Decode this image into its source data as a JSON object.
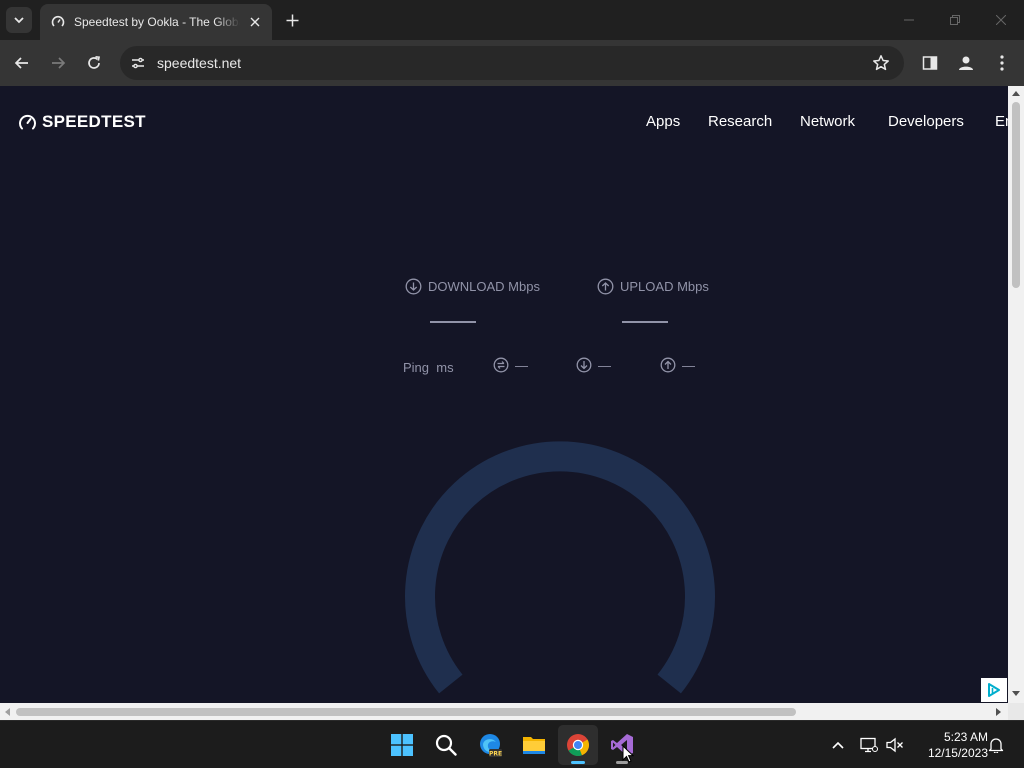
{
  "browser": {
    "tab_title": "Speedtest by Ookla - The Global Broadband Speed Test",
    "url": "speedtest.net"
  },
  "site": {
    "logo_text": "SPEEDTEST",
    "nav": [
      "Apps",
      "Research",
      "Network",
      "Developers",
      "En"
    ],
    "download_label": "DOWNLOAD Mbps",
    "upload_label": "UPLOAD Mbps",
    "ping_label": "Ping",
    "ping_unit": "ms",
    "jitter_value": "—",
    "ping_download_value": "—",
    "ping_upload_value": "—",
    "accent_color": "#141526",
    "gauge_color": "#1f2f4e",
    "text_muted_color": "#9193a8"
  },
  "taskbar": {
    "apps": [
      "start-icon",
      "search-icon",
      "edge-preview-icon",
      "file-explorer-icon",
      "chrome-icon",
      "visual-studio-icon"
    ],
    "time": "5:23 AM",
    "date": "12/15/2023"
  }
}
